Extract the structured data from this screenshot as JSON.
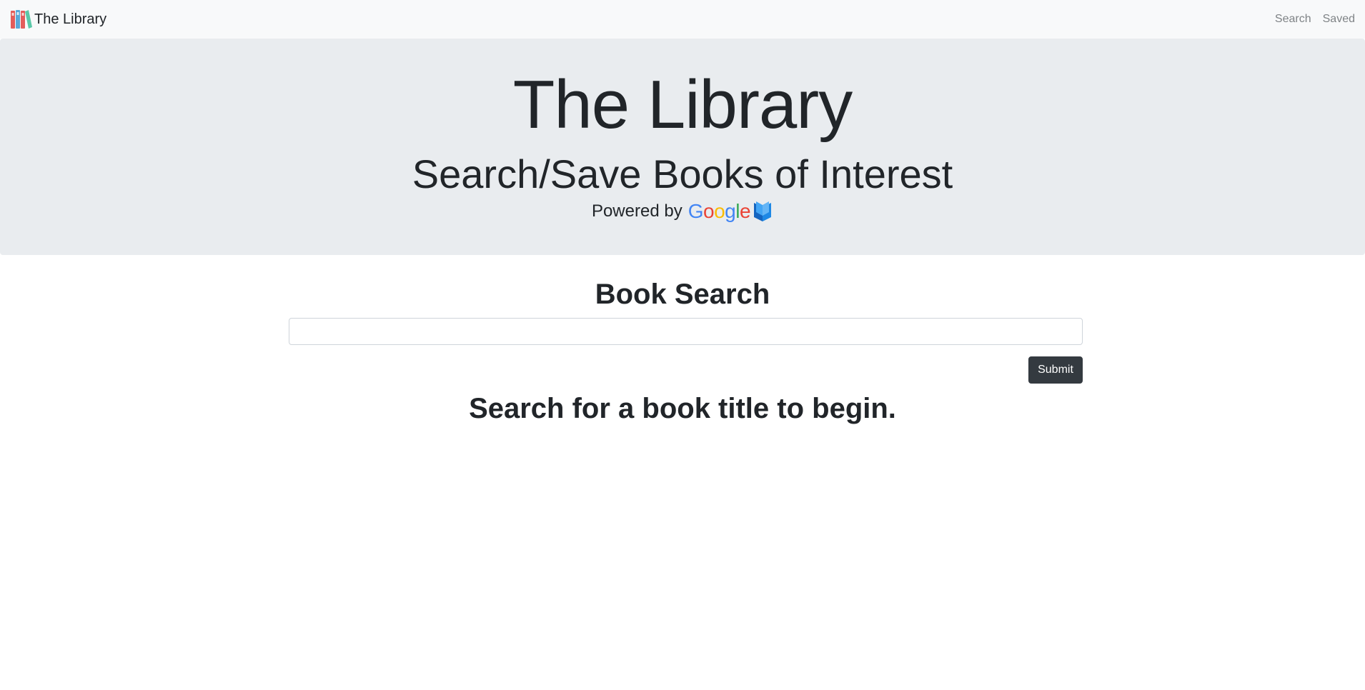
{
  "navbar": {
    "brand_label": "The Library",
    "brand_icon": "library-books-icon",
    "links": [
      {
        "label": "Search"
      },
      {
        "label": "Saved"
      }
    ]
  },
  "jumbotron": {
    "title": "The Library",
    "subtitle": "Search/Save Books of Interest",
    "powered_by_text": "Powered by",
    "google_logo": {
      "letters": [
        "G",
        "o",
        "o",
        "g",
        "l",
        "e"
      ],
      "colors": [
        "#4285F4",
        "#EA4335",
        "#FBBC05",
        "#4285F4",
        "#34A853",
        "#EA4335"
      ]
    },
    "google_books_icon": "google-books-icon"
  },
  "search": {
    "heading": "Book Search",
    "input_value": "",
    "input_placeholder": "",
    "submit_label": "Submit",
    "empty_message": "Search for a book title to begin."
  },
  "colors": {
    "navbar_bg": "#f8f9fa",
    "jumbotron_bg": "#e9ecef",
    "button_bg": "#343a40",
    "text": "#212529",
    "nav_link": "#7f8386"
  }
}
